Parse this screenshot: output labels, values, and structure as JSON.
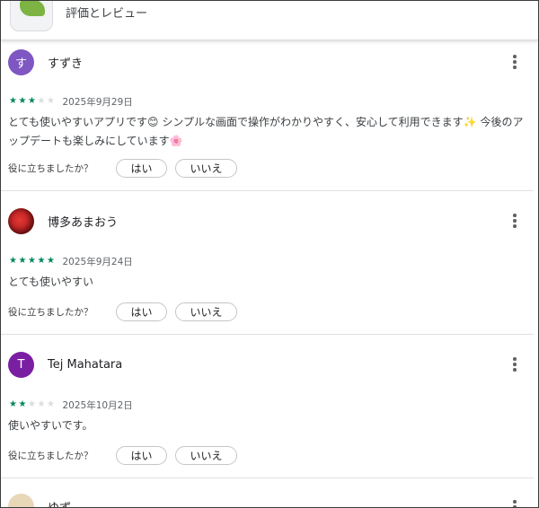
{
  "header": {
    "title": "評価とレビュー"
  },
  "helpful_question": "役に立ちましたか？",
  "helpful_yes": "はい",
  "helpful_no": "いいえ",
  "reviews": [
    {
      "name": "すずき",
      "avatar_letter": "す",
      "rating": 3,
      "date": "2025年9月29日",
      "text_parts": [
        "とても使いやすいアプリです",
        "😊",
        " シンプルな画面で操作がわかりやすく、安心して利用できます",
        "✨",
        " 今後のアップデートも楽しみにしています",
        "🌸"
      ]
    },
    {
      "name": "博多あまおう",
      "avatar_letter": "",
      "rating": 5,
      "date": "2025年9月24日",
      "text": "とても使いやすい"
    },
    {
      "name": "Tej Mahatara",
      "avatar_letter": "T",
      "rating": 2,
      "date": "2025年10月2日",
      "text": "使いやすいです。"
    },
    {
      "name": "ゆず",
      "avatar_letter": ""
    }
  ],
  "colors": {
    "star_filled": "#01875f",
    "star_empty": "#dadce0",
    "avatar_purple": "#7e57c2",
    "avatar_violet": "#7b1fa2"
  },
  "icons": {
    "more": "more-vert-icon",
    "star": "star-icon"
  }
}
